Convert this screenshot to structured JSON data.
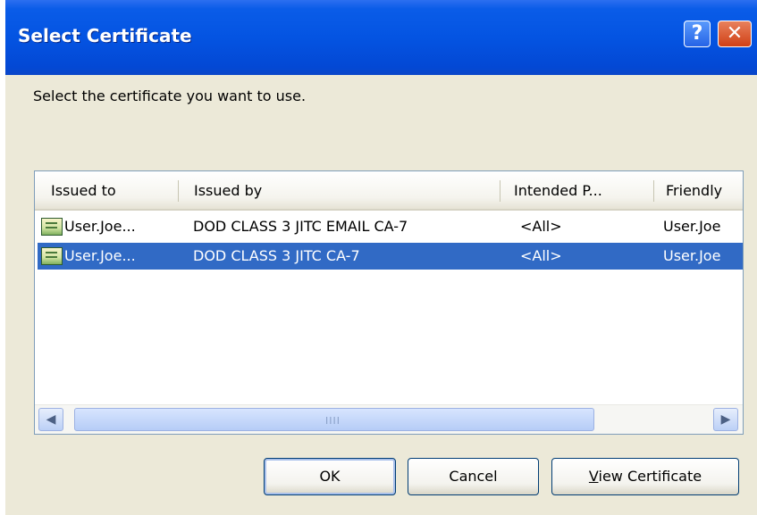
{
  "window": {
    "title": "Select Certificate",
    "help_glyph": "?",
    "close_glyph": "✕"
  },
  "prompt": "Select the certificate you want to use.",
  "table": {
    "columns": [
      "Issued to",
      "Issued by",
      "Intended P...",
      "Friendly"
    ],
    "rows": [
      {
        "issued_to": "User.Joe...",
        "issued_by": "DOD CLASS 3 JITC EMAIL CA-7",
        "intended": "<All>",
        "friendly": "User.Joe",
        "selected": false
      },
      {
        "issued_to": "User.Joe...",
        "issued_by": "DOD CLASS 3 JITC CA-7",
        "intended": "<All>",
        "friendly": "User.Joe",
        "selected": true
      }
    ]
  },
  "scrollbar": {
    "left_arrow": "◀",
    "right_arrow": "▶",
    "grip": "IIII"
  },
  "buttons": {
    "ok": "OK",
    "cancel": "Cancel",
    "view_first": "V",
    "view_rest": "iew Certificate"
  },
  "colors": {
    "titlebar": "#0454e2",
    "selection": "#316ac5",
    "dialog": "#ece9d8"
  }
}
